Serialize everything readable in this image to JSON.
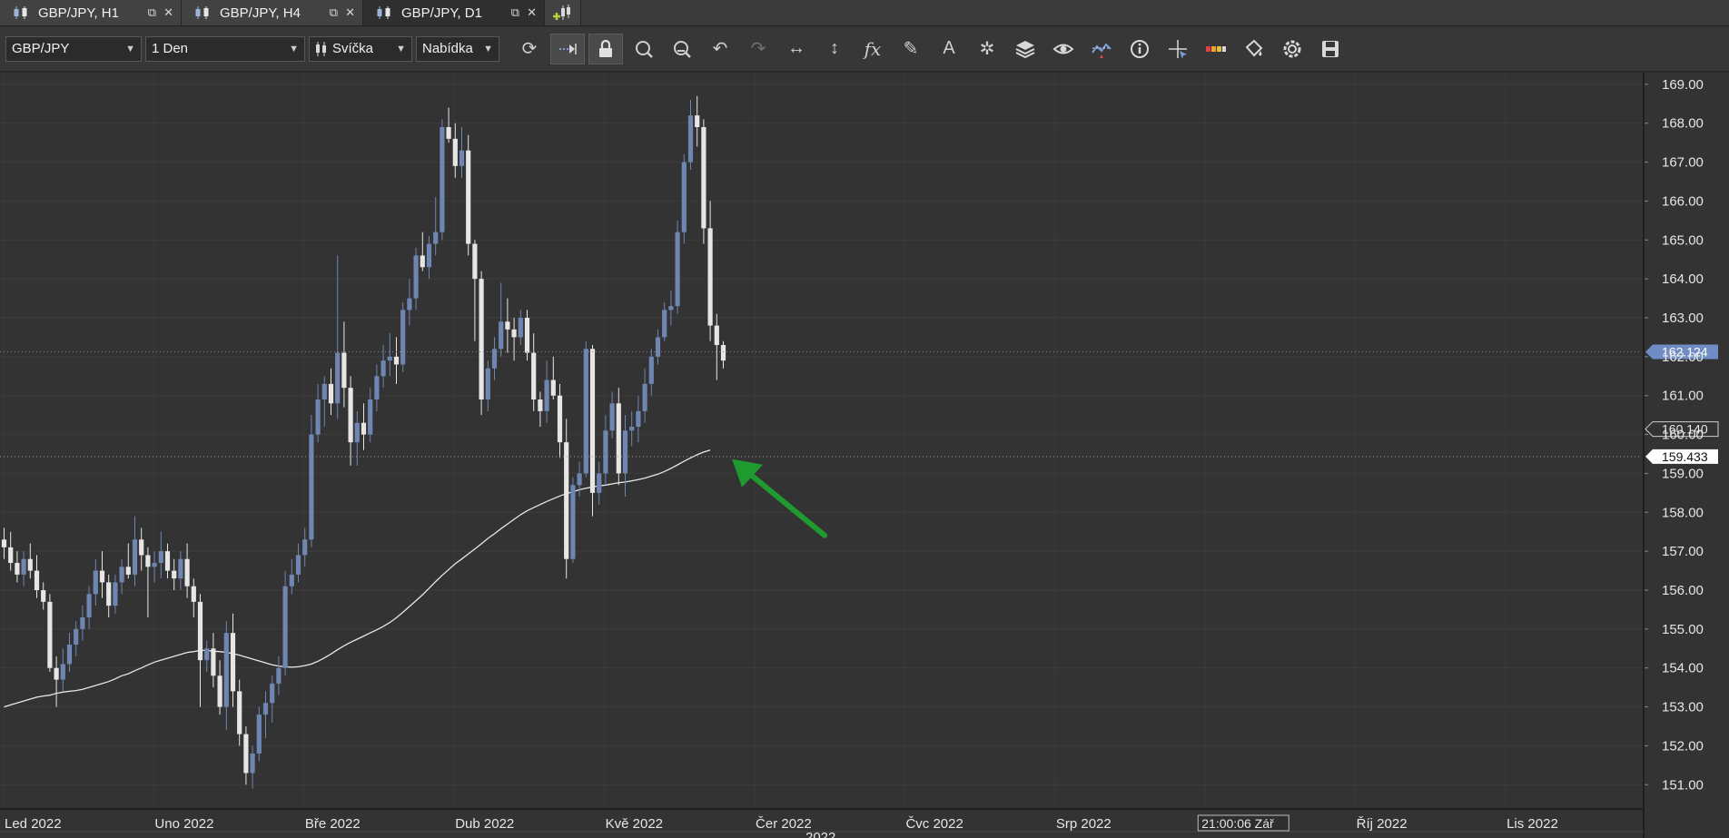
{
  "tabs": [
    {
      "label": "GBP/JPY, H1",
      "active": false
    },
    {
      "label": "GBP/JPY, H4",
      "active": false
    },
    {
      "label": "GBP/JPY, D1",
      "active": true
    }
  ],
  "toolbar": {
    "instrument": "GBP/JPY",
    "period": "1 Den",
    "chart_type": "Svíčka",
    "price_side": "Nabídka",
    "icons": [
      "refresh-icon",
      "shift-icon",
      "lock-icon",
      "zoom-in-icon",
      "zoom-out-icon",
      "undo-icon",
      "redo-icon",
      "horizontal-scale-icon",
      "vertical-scale-icon",
      "indicator-fx-icon",
      "pencil-icon",
      "text-icon",
      "pattern-icon",
      "layers-icon",
      "eye-icon",
      "signals-icon",
      "info-icon",
      "cursor-icon",
      "color-scale-icon",
      "paint-icon",
      "settings-icon",
      "save-icon"
    ]
  },
  "colors": {
    "background": "#333333",
    "bull": "#6f86b3",
    "bear": "#e6e6e6",
    "ma": "#e8e8e8",
    "arrow": "#1f9a2f",
    "price_marker": "#6f8cc4"
  },
  "chart_data": {
    "type": "candlestick",
    "symbol": "GBP/JPY",
    "timeframe": "1 Den",
    "ylim": [
      150.4,
      169.3
    ],
    "y_ticks": [
      169.0,
      168.0,
      167.0,
      166.0,
      165.0,
      164.0,
      163.0,
      162.0,
      161.0,
      160.0,
      159.0,
      158.0,
      157.0,
      156.0,
      155.0,
      154.0,
      153.0,
      152.0,
      151.0
    ],
    "x_labels": [
      "Led 2022",
      "Uno 2022",
      "Bře 2022",
      "Dub 2022",
      "Kvě 2022",
      "Čer 2022",
      "Čvc 2022",
      "Srp 2022",
      "Zář",
      "Říj 2022",
      "Lis 2022"
    ],
    "year_label": "2022",
    "cursor_time_label": "21:00:06 Zář",
    "current_price": "162.124",
    "current_price_value": 162.124,
    "ma_marker_label": "160.140",
    "ma_marker_value": 160.14,
    "line_marker_label": "159.433",
    "line_marker_value": 159.433,
    "candles": [
      [
        157.3,
        157.6,
        156.8,
        157.1
      ],
      [
        157.1,
        157.5,
        156.5,
        156.7
      ],
      [
        156.7,
        157.0,
        156.2,
        156.4
      ],
      [
        156.4,
        157.0,
        156.1,
        156.8
      ],
      [
        156.8,
        157.2,
        156.3,
        156.5
      ],
      [
        156.5,
        156.9,
        155.8,
        156.0
      ],
      [
        156.0,
        156.2,
        155.5,
        155.7
      ],
      [
        155.7,
        155.9,
        153.9,
        154.0
      ],
      [
        154.0,
        154.3,
        153.0,
        153.7
      ],
      [
        153.7,
        154.5,
        153.4,
        154.1
      ],
      [
        154.1,
        154.9,
        153.9,
        154.6
      ],
      [
        154.6,
        155.2,
        154.3,
        155.0
      ],
      [
        155.0,
        155.6,
        154.7,
        155.3
      ],
      [
        155.3,
        156.1,
        155.0,
        155.9
      ],
      [
        155.9,
        156.8,
        155.6,
        156.5
      ],
      [
        156.5,
        157.0,
        155.8,
        156.2
      ],
      [
        156.2,
        156.4,
        155.3,
        155.6
      ],
      [
        155.6,
        156.4,
        155.4,
        156.2
      ],
      [
        156.2,
        156.8,
        155.9,
        156.6
      ],
      [
        156.6,
        157.2,
        156.3,
        156.4
      ],
      [
        156.4,
        157.9,
        156.1,
        157.3
      ],
      [
        157.3,
        157.6,
        156.5,
        156.9
      ],
      [
        156.9,
        157.1,
        155.3,
        156.6
      ],
      [
        156.6,
        157.0,
        156.2,
        156.7
      ],
      [
        156.7,
        157.5,
        156.3,
        157.0
      ],
      [
        157.0,
        157.2,
        156.3,
        156.5
      ],
      [
        156.5,
        156.8,
        156.0,
        156.3
      ],
      [
        156.3,
        157.0,
        156.0,
        156.8
      ],
      [
        156.8,
        157.2,
        155.8,
        156.1
      ],
      [
        156.1,
        156.3,
        155.3,
        155.7
      ],
      [
        155.7,
        155.9,
        153.0,
        154.2
      ],
      [
        154.2,
        154.7,
        153.9,
        154.5
      ],
      [
        154.5,
        154.9,
        153.5,
        153.8
      ],
      [
        153.8,
        154.2,
        152.8,
        153.0
      ],
      [
        153.0,
        155.2,
        152.4,
        154.9
      ],
      [
        154.9,
        155.4,
        153.0,
        153.4
      ],
      [
        153.4,
        153.7,
        152.0,
        152.3
      ],
      [
        152.3,
        152.5,
        151.0,
        151.3
      ],
      [
        151.3,
        152.0,
        150.9,
        151.8
      ],
      [
        151.8,
        153.0,
        151.6,
        152.8
      ],
      [
        152.8,
        153.4,
        152.2,
        153.1
      ],
      [
        153.1,
        153.8,
        152.6,
        153.6
      ],
      [
        153.6,
        154.3,
        153.3,
        154.0
      ],
      [
        154.0,
        156.5,
        153.8,
        156.1
      ],
      [
        156.1,
        156.8,
        155.9,
        156.4
      ],
      [
        156.4,
        157.2,
        156.2,
        156.9
      ],
      [
        156.9,
        157.6,
        156.6,
        157.3
      ],
      [
        157.3,
        160.5,
        157.1,
        160.0
      ],
      [
        160.0,
        161.3,
        159.8,
        160.9
      ],
      [
        160.9,
        161.5,
        160.2,
        161.3
      ],
      [
        161.3,
        161.7,
        160.5,
        160.8
      ],
      [
        160.8,
        164.6,
        160.4,
        162.1
      ],
      [
        162.1,
        162.9,
        160.7,
        161.2
      ],
      [
        161.2,
        161.5,
        159.2,
        159.8
      ],
      [
        159.8,
        160.6,
        159.2,
        160.3
      ],
      [
        160.3,
        160.8,
        159.6,
        160.0
      ],
      [
        160.0,
        161.2,
        159.8,
        160.9
      ],
      [
        160.9,
        161.8,
        160.6,
        161.5
      ],
      [
        161.5,
        162.3,
        161.2,
        161.9
      ],
      [
        161.9,
        162.6,
        161.5,
        162.0
      ],
      [
        162.0,
        162.5,
        161.3,
        161.8
      ],
      [
        161.8,
        163.4,
        161.6,
        163.2
      ],
      [
        163.2,
        164.0,
        162.8,
        163.5
      ],
      [
        163.5,
        164.8,
        163.2,
        164.6
      ],
      [
        164.6,
        165.2,
        164.2,
        164.3
      ],
      [
        164.3,
        165.1,
        164.0,
        164.9
      ],
      [
        164.9,
        166.1,
        164.6,
        165.2
      ],
      [
        165.2,
        168.1,
        165.0,
        167.9
      ],
      [
        167.9,
        168.4,
        167.5,
        167.6
      ],
      [
        167.6,
        168.0,
        166.6,
        166.9
      ],
      [
        166.9,
        167.9,
        166.6,
        167.3
      ],
      [
        167.3,
        167.7,
        164.6,
        164.9
      ],
      [
        164.9,
        165.0,
        162.4,
        164.0
      ],
      [
        164.0,
        164.2,
        160.5,
        160.9
      ],
      [
        160.9,
        161.9,
        160.6,
        161.7
      ],
      [
        161.7,
        162.5,
        161.4,
        162.2
      ],
      [
        162.2,
        163.9,
        162.0,
        162.9
      ],
      [
        162.9,
        163.5,
        162.1,
        162.7
      ],
      [
        162.7,
        163.0,
        161.9,
        162.5
      ],
      [
        162.5,
        163.2,
        162.3,
        163.0
      ],
      [
        163.0,
        163.2,
        161.9,
        162.1
      ],
      [
        162.1,
        162.6,
        160.6,
        160.9
      ],
      [
        160.9,
        161.1,
        160.2,
        160.6
      ],
      [
        160.6,
        161.9,
        160.3,
        161.4
      ],
      [
        161.4,
        162.0,
        160.9,
        161.0
      ],
      [
        161.0,
        161.3,
        159.4,
        159.8
      ],
      [
        159.8,
        160.4,
        156.3,
        156.8
      ],
      [
        156.8,
        158.9,
        156.7,
        158.7
      ],
      [
        158.7,
        159.3,
        158.4,
        159.0
      ],
      [
        159.0,
        162.4,
        158.9,
        162.2
      ],
      [
        162.2,
        162.3,
        157.9,
        158.5
      ],
      [
        158.5,
        159.3,
        158.2,
        159.0
      ],
      [
        159.0,
        160.5,
        158.7,
        160.1
      ],
      [
        160.1,
        161.1,
        159.9,
        160.8
      ],
      [
        160.8,
        161.2,
        158.7,
        159.0
      ],
      [
        159.0,
        160.5,
        158.4,
        160.1
      ],
      [
        160.1,
        160.6,
        159.7,
        160.2
      ],
      [
        160.2,
        161.0,
        159.8,
        160.6
      ],
      [
        160.6,
        161.7,
        160.3,
        161.3
      ],
      [
        161.3,
        162.2,
        161.0,
        162.0
      ],
      [
        162.0,
        162.7,
        161.8,
        162.5
      ],
      [
        162.5,
        163.4,
        162.4,
        163.2
      ],
      [
        163.2,
        163.7,
        162.8,
        163.3
      ],
      [
        163.3,
        165.5,
        163.1,
        165.2
      ],
      [
        165.2,
        167.2,
        164.9,
        167.0
      ],
      [
        167.0,
        168.6,
        166.8,
        168.2
      ],
      [
        168.2,
        168.7,
        167.4,
        167.9
      ],
      [
        167.9,
        168.1,
        164.9,
        165.3
      ],
      [
        165.3,
        166.0,
        162.4,
        162.8
      ],
      [
        162.8,
        163.1,
        161.4,
        162.3
      ],
      [
        162.3,
        162.4,
        161.7,
        161.9
      ]
    ],
    "moving_average": [
      153.0,
      153.05,
      153.1,
      153.15,
      153.2,
      153.25,
      153.28,
      153.3,
      153.35,
      153.38,
      153.4,
      153.42,
      153.45,
      153.5,
      153.55,
      153.6,
      153.65,
      153.72,
      153.8,
      153.85,
      153.93,
      154.0,
      154.08,
      154.15,
      154.2,
      154.25,
      154.3,
      154.35,
      154.4,
      154.42,
      154.45,
      154.45,
      154.43,
      154.42,
      154.4,
      154.37,
      154.33,
      154.28,
      154.23,
      154.18,
      154.13,
      154.08,
      154.05,
      154.03,
      154.02,
      154.03,
      154.06,
      154.1,
      154.17,
      154.26,
      154.36,
      154.47,
      154.57,
      154.66,
      154.74,
      154.82,
      154.9,
      154.98,
      155.07,
      155.17,
      155.29,
      155.43,
      155.58,
      155.73,
      155.88,
      156.05,
      156.22,
      156.38,
      156.53,
      156.68,
      156.8,
      156.93,
      157.06,
      157.19,
      157.33,
      157.45,
      157.58,
      157.7,
      157.82,
      157.94,
      158.04,
      158.12,
      158.2,
      158.28,
      158.35,
      158.42,
      158.48,
      158.53,
      158.58,
      158.62,
      158.65,
      158.68,
      158.7,
      158.73,
      158.76,
      158.78,
      158.81,
      158.84,
      158.88,
      158.93,
      158.98,
      159.05,
      159.13,
      159.22,
      159.31,
      159.4,
      159.48,
      159.55,
      159.6
    ]
  }
}
